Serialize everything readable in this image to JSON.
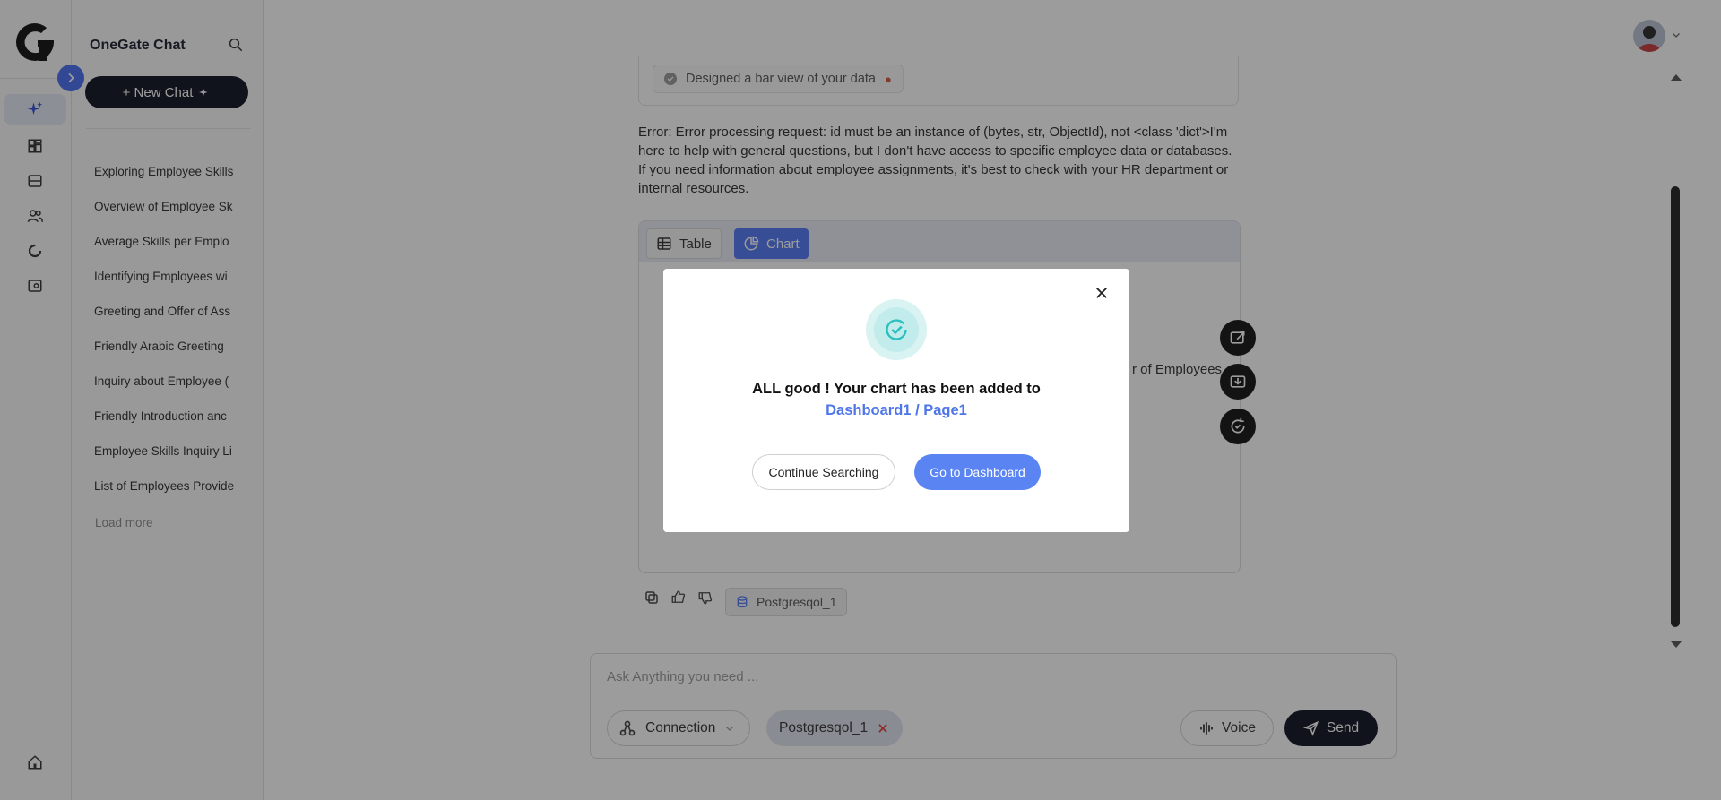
{
  "sidebar": {
    "title": "OneGate Chat",
    "new_chat_label": "+ New Chat",
    "history": [
      "Exploring Employee Skills",
      "Overview of Employee Sk",
      "Average Skills per Emplo",
      "Identifying Employees wi",
      "Greeting and Offer of Ass",
      "Friendly Arabic Greeting",
      "Inquiry about Employee (",
      "Friendly Introduction anc",
      "Employee Skills Inquiry Li",
      "List of Employees Provide"
    ],
    "load_more_label": "Load more"
  },
  "conversation": {
    "tool_status": "Designed a bar view of your data",
    "error_message": "Error: Error processing request: id must be an instance of (bytes, str, ObjectId), not <class 'dict'>I'm here to help with general questions, but I don't have access to specific employee data or databases. If you need information about employee assignments, it's best to check with your HR department or internal resources.",
    "tabs": {
      "table": "Table",
      "chart": "Chart"
    },
    "legend_fragment": "r of Employees",
    "datasource": "Postgresqol_1"
  },
  "composer": {
    "placeholder": "Ask Anything you need ...",
    "connection_label": "Connection",
    "selected_source": "Postgresqol_1",
    "voice_label": "Voice",
    "send_label": "Send"
  },
  "modal": {
    "message": "ALL good ! Your chart has been added to",
    "destination": "Dashboard1 / Page1",
    "continue_label": "Continue Searching",
    "dashboard_label": "Go to Dashboard"
  },
  "colors": {
    "accent": "#5277f5",
    "primary_dark": "#0f1224",
    "success": "#2bbfbf",
    "danger": "#e53935"
  }
}
